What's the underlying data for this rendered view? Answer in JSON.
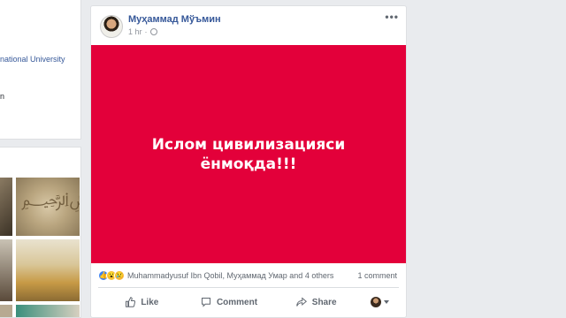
{
  "left": {
    "university_text": "national University",
    "cut_text": "n"
  },
  "post": {
    "author": "Муҳаммад Мўъмин",
    "time": "1 hr",
    "more_label": "•••",
    "banner_text": "Ислом цивилизацияси ёнмоқда!!!",
    "banner_color": "#e3003a",
    "reactions": {
      "icons": [
        "like-icon",
        "wow-icon",
        "sad-icon"
      ],
      "names": "Muhammadyusuf Ibn Qobil, Муҳаммад Умар and 4 others"
    },
    "comments_count": "1 comment",
    "actions": {
      "like": "Like",
      "comment": "Comment",
      "share": "Share"
    }
  }
}
